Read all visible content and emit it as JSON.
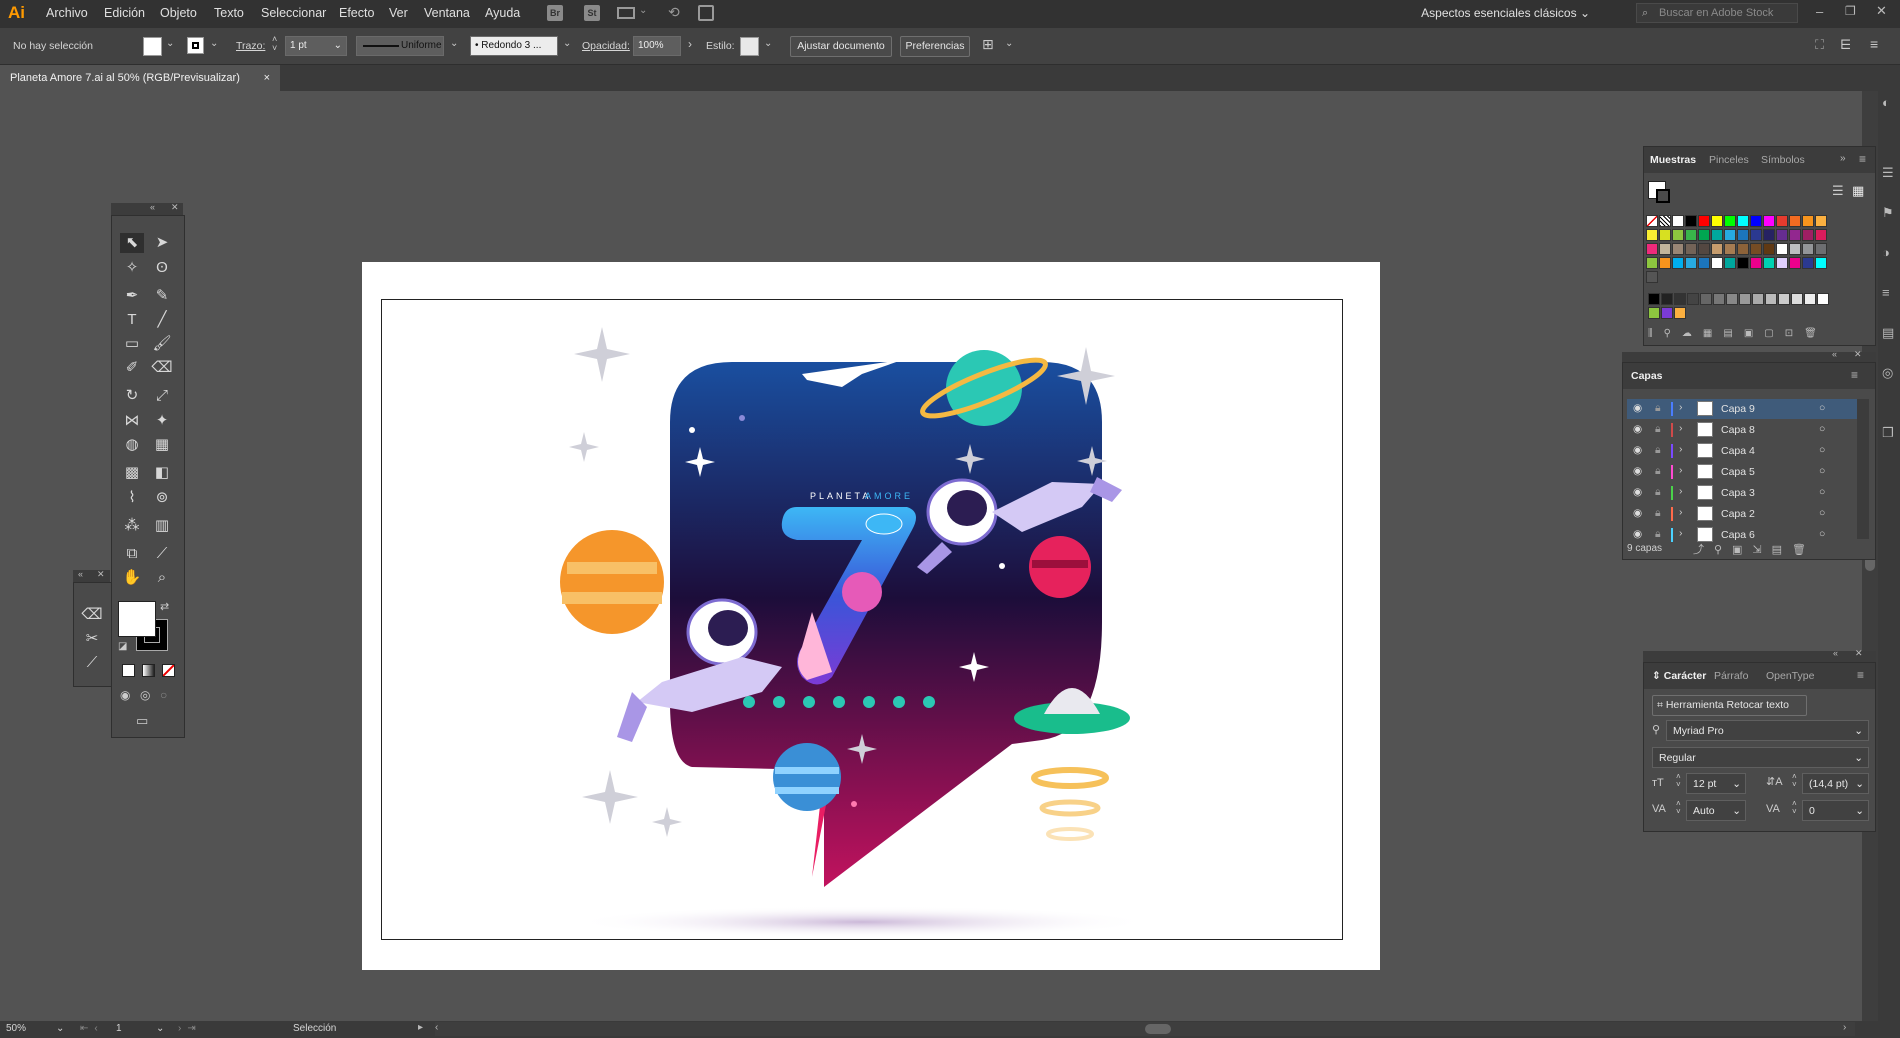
{
  "app": {
    "logo": "Ai",
    "accent": "#ff9a00"
  },
  "menu": {
    "items": [
      "Archivo",
      "Edición",
      "Objeto",
      "Texto",
      "Seleccionar",
      "Efecto",
      "Ver",
      "Ventana",
      "Ayuda"
    ],
    "bridge": "Br",
    "stock": "St",
    "workspace": "Aspectos esenciales clásicos",
    "search_placeholder": "Buscar en Adobe Stock"
  },
  "control": {
    "selection": "No hay selección",
    "stroke_label": "Trazo:",
    "stroke_value": "1 pt",
    "profile": "Uniforme",
    "brush": "Redondo 3 ...",
    "opacity_label": "Opacidad:",
    "opacity_value": "100%",
    "style_label": "Estilo:",
    "adjust_button": "Ajustar documento",
    "prefs_button": "Preferencias"
  },
  "document": {
    "tab": "Planeta Amore 7.ai al 50% (RGB/Previsualizar)",
    "close": "×"
  },
  "artwork": {
    "title_left": "PLANETA",
    "title_right": "AMORE",
    "number": "7"
  },
  "swatches_panel": {
    "tabs": [
      "Muestras",
      "Pinceles",
      "Símbolos"
    ]
  },
  "layers_panel": {
    "title": "Capas",
    "layers": [
      {
        "name": "Capa 9",
        "color": "#4a7dff",
        "selected": true
      },
      {
        "name": "Capa 8",
        "color": "#d04a4a",
        "selected": false
      },
      {
        "name": "Capa 4",
        "color": "#7a4aff",
        "selected": false
      },
      {
        "name": "Capa 5",
        "color": "#ff4ad2",
        "selected": false
      },
      {
        "name": "Capa 3",
        "color": "#4ad24a",
        "selected": false
      },
      {
        "name": "Capa 2",
        "color": "#ff6a4a",
        "selected": false
      },
      {
        "name": "Capa 6",
        "color": "#4ad2ff",
        "selected": false
      }
    ],
    "count": "9 capas"
  },
  "character_panel": {
    "tabs": [
      "Carácter",
      "Párrafo",
      "OpenType"
    ],
    "touch_type": "Herramienta Retocar texto",
    "font_family": "Myriad Pro",
    "font_style": "Regular",
    "font_size": "12 pt",
    "leading": "(14,4 pt)",
    "kerning": "Auto",
    "tracking": "0"
  },
  "status": {
    "zoom": "50%",
    "artboard": "1",
    "tool": "Selección"
  }
}
